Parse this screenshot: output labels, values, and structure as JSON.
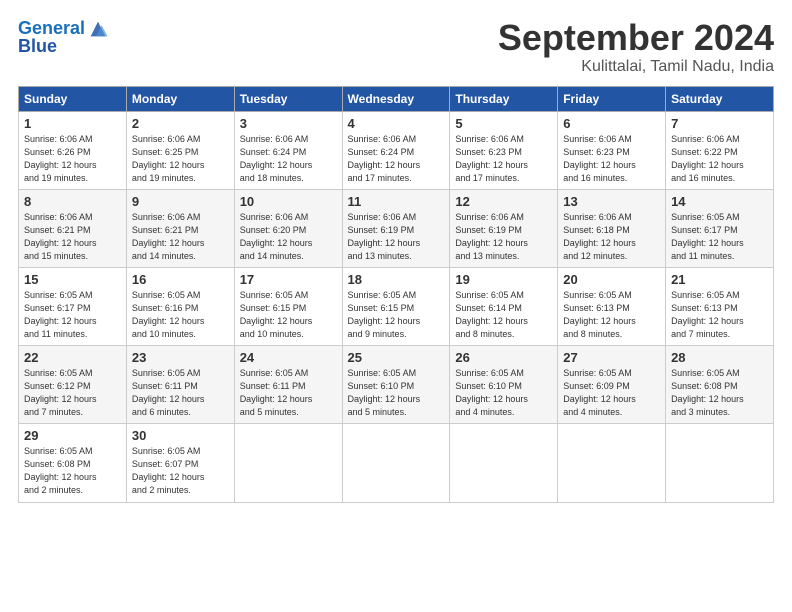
{
  "header": {
    "logo_line1": "General",
    "logo_line2": "Blue",
    "month": "September 2024",
    "location": "Kulittalai, Tamil Nadu, India"
  },
  "days_of_week": [
    "Sunday",
    "Monday",
    "Tuesday",
    "Wednesday",
    "Thursday",
    "Friday",
    "Saturday"
  ],
  "weeks": [
    [
      {
        "day": "1",
        "info": "Sunrise: 6:06 AM\nSunset: 6:26 PM\nDaylight: 12 hours\nand 19 minutes."
      },
      {
        "day": "2",
        "info": "Sunrise: 6:06 AM\nSunset: 6:25 PM\nDaylight: 12 hours\nand 19 minutes."
      },
      {
        "day": "3",
        "info": "Sunrise: 6:06 AM\nSunset: 6:24 PM\nDaylight: 12 hours\nand 18 minutes."
      },
      {
        "day": "4",
        "info": "Sunrise: 6:06 AM\nSunset: 6:24 PM\nDaylight: 12 hours\nand 17 minutes."
      },
      {
        "day": "5",
        "info": "Sunrise: 6:06 AM\nSunset: 6:23 PM\nDaylight: 12 hours\nand 17 minutes."
      },
      {
        "day": "6",
        "info": "Sunrise: 6:06 AM\nSunset: 6:23 PM\nDaylight: 12 hours\nand 16 minutes."
      },
      {
        "day": "7",
        "info": "Sunrise: 6:06 AM\nSunset: 6:22 PM\nDaylight: 12 hours\nand 16 minutes."
      }
    ],
    [
      {
        "day": "8",
        "info": "Sunrise: 6:06 AM\nSunset: 6:21 PM\nDaylight: 12 hours\nand 15 minutes."
      },
      {
        "day": "9",
        "info": "Sunrise: 6:06 AM\nSunset: 6:21 PM\nDaylight: 12 hours\nand 14 minutes."
      },
      {
        "day": "10",
        "info": "Sunrise: 6:06 AM\nSunset: 6:20 PM\nDaylight: 12 hours\nand 14 minutes."
      },
      {
        "day": "11",
        "info": "Sunrise: 6:06 AM\nSunset: 6:19 PM\nDaylight: 12 hours\nand 13 minutes."
      },
      {
        "day": "12",
        "info": "Sunrise: 6:06 AM\nSunset: 6:19 PM\nDaylight: 12 hours\nand 13 minutes."
      },
      {
        "day": "13",
        "info": "Sunrise: 6:06 AM\nSunset: 6:18 PM\nDaylight: 12 hours\nand 12 minutes."
      },
      {
        "day": "14",
        "info": "Sunrise: 6:05 AM\nSunset: 6:17 PM\nDaylight: 12 hours\nand 11 minutes."
      }
    ],
    [
      {
        "day": "15",
        "info": "Sunrise: 6:05 AM\nSunset: 6:17 PM\nDaylight: 12 hours\nand 11 minutes."
      },
      {
        "day": "16",
        "info": "Sunrise: 6:05 AM\nSunset: 6:16 PM\nDaylight: 12 hours\nand 10 minutes."
      },
      {
        "day": "17",
        "info": "Sunrise: 6:05 AM\nSunset: 6:15 PM\nDaylight: 12 hours\nand 10 minutes."
      },
      {
        "day": "18",
        "info": "Sunrise: 6:05 AM\nSunset: 6:15 PM\nDaylight: 12 hours\nand 9 minutes."
      },
      {
        "day": "19",
        "info": "Sunrise: 6:05 AM\nSunset: 6:14 PM\nDaylight: 12 hours\nand 8 minutes."
      },
      {
        "day": "20",
        "info": "Sunrise: 6:05 AM\nSunset: 6:13 PM\nDaylight: 12 hours\nand 8 minutes."
      },
      {
        "day": "21",
        "info": "Sunrise: 6:05 AM\nSunset: 6:13 PM\nDaylight: 12 hours\nand 7 minutes."
      }
    ],
    [
      {
        "day": "22",
        "info": "Sunrise: 6:05 AM\nSunset: 6:12 PM\nDaylight: 12 hours\nand 7 minutes."
      },
      {
        "day": "23",
        "info": "Sunrise: 6:05 AM\nSunset: 6:11 PM\nDaylight: 12 hours\nand 6 minutes."
      },
      {
        "day": "24",
        "info": "Sunrise: 6:05 AM\nSunset: 6:11 PM\nDaylight: 12 hours\nand 5 minutes."
      },
      {
        "day": "25",
        "info": "Sunrise: 6:05 AM\nSunset: 6:10 PM\nDaylight: 12 hours\nand 5 minutes."
      },
      {
        "day": "26",
        "info": "Sunrise: 6:05 AM\nSunset: 6:10 PM\nDaylight: 12 hours\nand 4 minutes."
      },
      {
        "day": "27",
        "info": "Sunrise: 6:05 AM\nSunset: 6:09 PM\nDaylight: 12 hours\nand 4 minutes."
      },
      {
        "day": "28",
        "info": "Sunrise: 6:05 AM\nSunset: 6:08 PM\nDaylight: 12 hours\nand 3 minutes."
      }
    ],
    [
      {
        "day": "29",
        "info": "Sunrise: 6:05 AM\nSunset: 6:08 PM\nDaylight: 12 hours\nand 2 minutes."
      },
      {
        "day": "30",
        "info": "Sunrise: 6:05 AM\nSunset: 6:07 PM\nDaylight: 12 hours\nand 2 minutes."
      },
      {
        "day": "",
        "info": ""
      },
      {
        "day": "",
        "info": ""
      },
      {
        "day": "",
        "info": ""
      },
      {
        "day": "",
        "info": ""
      },
      {
        "day": "",
        "info": ""
      }
    ]
  ]
}
